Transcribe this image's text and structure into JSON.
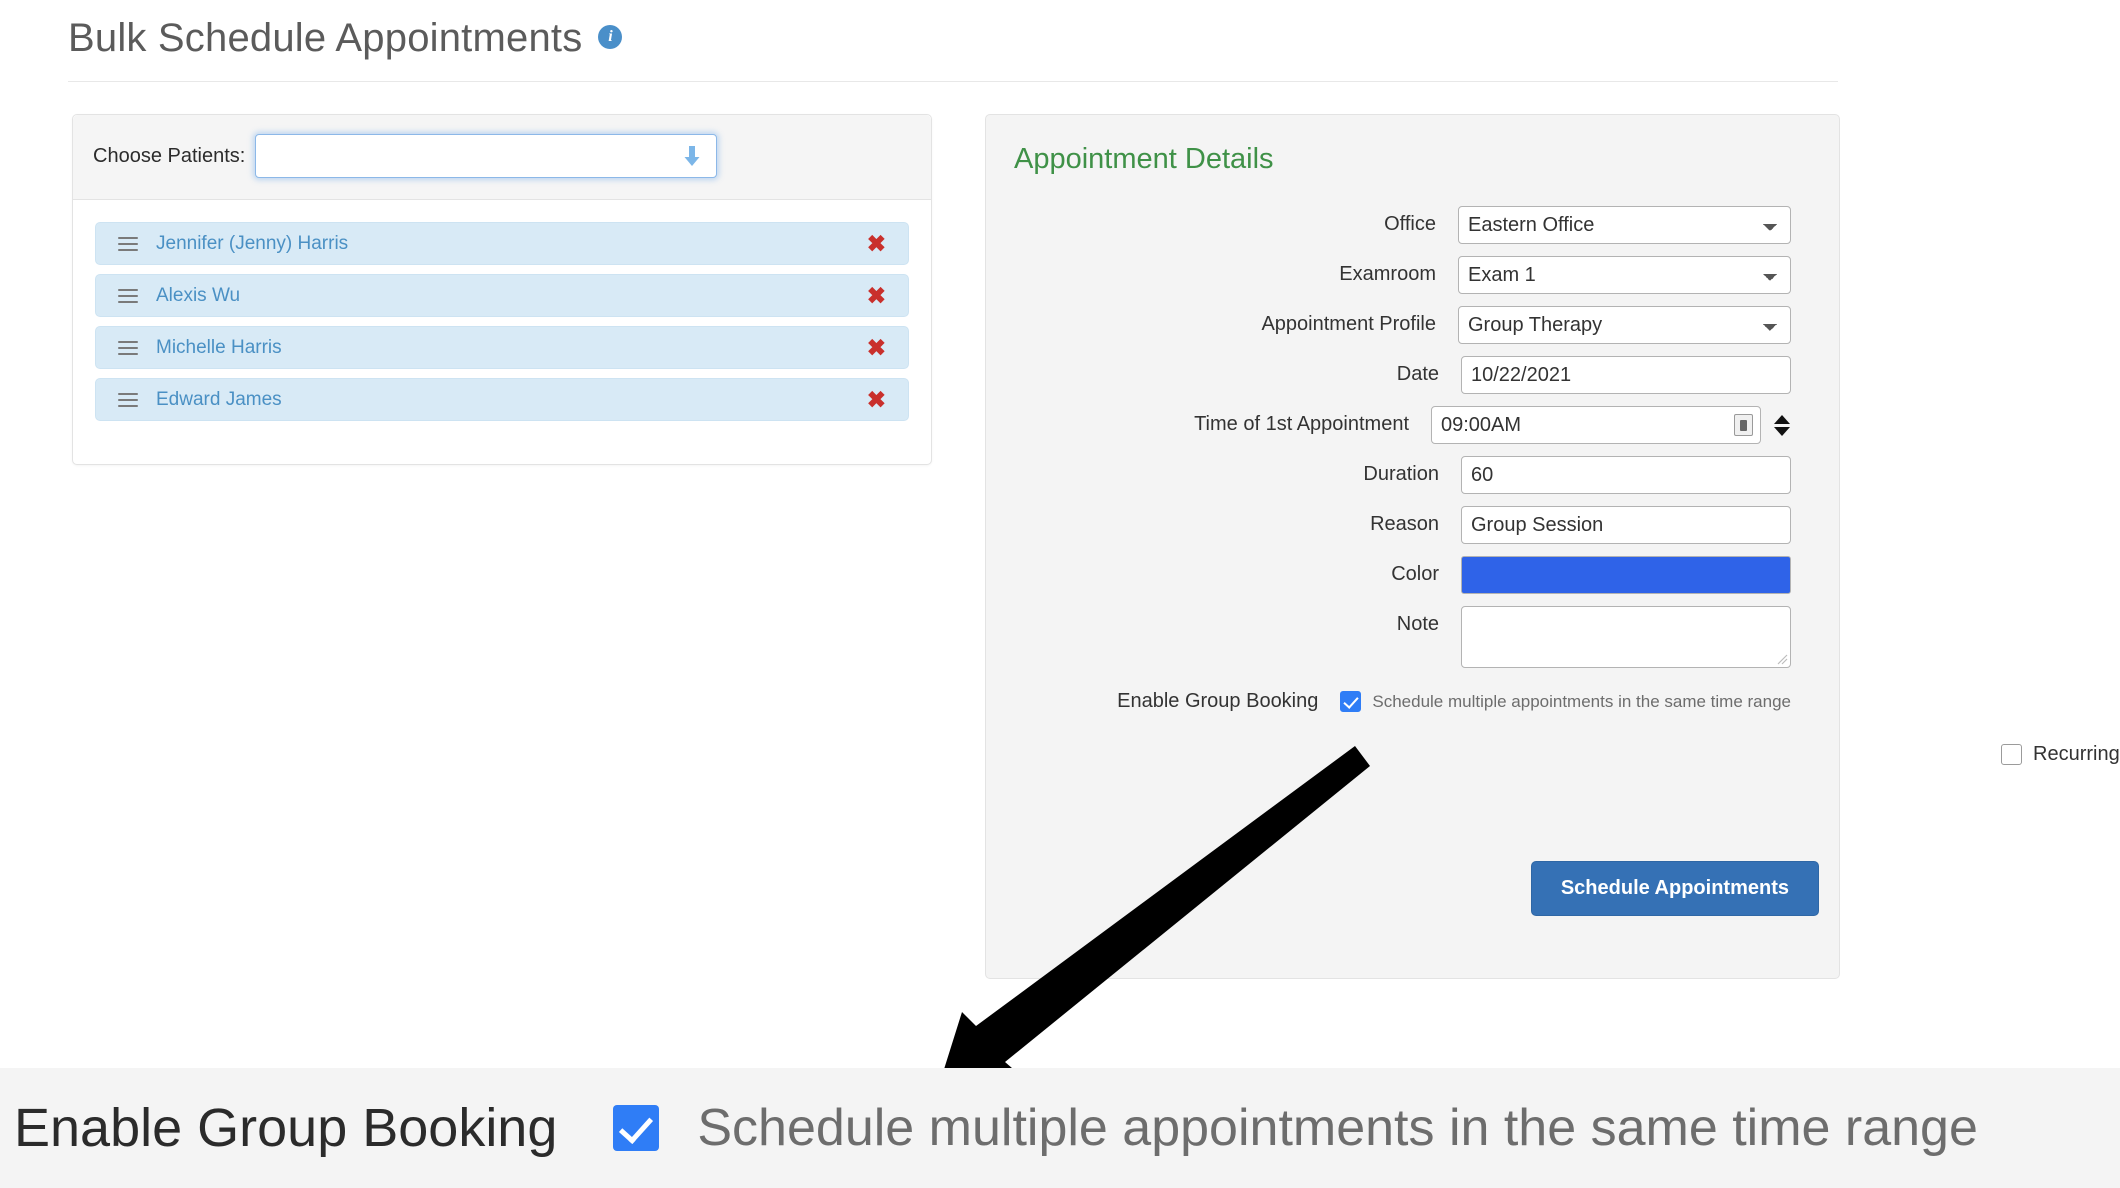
{
  "header": {
    "title": "Bulk Schedule Appointments",
    "info_icon": "info-circle-icon",
    "info_glyph": "i"
  },
  "patients_panel": {
    "choose_label": "Choose Patients:",
    "select_value": "",
    "select_placeholder": "",
    "dropdown_icon": "down-arrow-icon",
    "items": [
      {
        "name": "Jennifer (Jenny) Harris",
        "handle_icon": "drag-handle-icon",
        "remove_icon": "close-x-icon",
        "remove_glyph": "✖"
      },
      {
        "name": "Alexis Wu",
        "handle_icon": "drag-handle-icon",
        "remove_icon": "close-x-icon",
        "remove_glyph": "✖"
      },
      {
        "name": "Michelle Harris",
        "handle_icon": "drag-handle-icon",
        "remove_icon": "close-x-icon",
        "remove_glyph": "✖"
      },
      {
        "name": "Edward James",
        "handle_icon": "drag-handle-icon",
        "remove_icon": "close-x-icon",
        "remove_glyph": "✖"
      }
    ]
  },
  "details_panel": {
    "title": "Appointment Details",
    "fields": {
      "office": {
        "label": "Office",
        "value": "Eastern Office"
      },
      "examroom": {
        "label": "Examroom",
        "value": "Exam 1"
      },
      "appointment_profile": {
        "label": "Appointment Profile",
        "value": "Group Therapy"
      },
      "date": {
        "label": "Date",
        "value": "10/22/2021"
      },
      "time_first": {
        "label": "Time of 1st Appointment",
        "value": "09:00AM",
        "picker_icon": "time-picker-icon",
        "spinner_icon": "up-down-spinner-icon"
      },
      "duration": {
        "label": "Duration",
        "value": "60"
      },
      "reason": {
        "label": "Reason",
        "value": "Group Session"
      },
      "color": {
        "label": "Color",
        "value": "#2f63e8"
      },
      "note": {
        "label": "Note",
        "value": "",
        "resize_icon": "resize-grip-icon"
      }
    },
    "group_booking": {
      "label": "Enable Group Booking",
      "checked": true,
      "description": "Schedule multiple appointments in the same time range"
    },
    "recurring": {
      "label": "Recurring Appointment",
      "checked": false
    },
    "submit_label": "Schedule Appointments"
  },
  "annotation": {
    "arrow_icon": "callout-arrow-icon"
  },
  "zoom_strip": {
    "label": "Enable Group Booking",
    "checkbox_icon": "checked-checkbox-icon",
    "checked": true,
    "description": "Schedule multiple appointments in the same time range"
  },
  "colors": {
    "accent_blue": "#3571b5",
    "title_green": "#3f9147",
    "patient_row_bg": "#d8eaf6",
    "patient_name": "#4a90c4",
    "remove_red": "#c9302c",
    "checkbox_blue": "#2f7df6",
    "color_value": "#2f63e8"
  }
}
